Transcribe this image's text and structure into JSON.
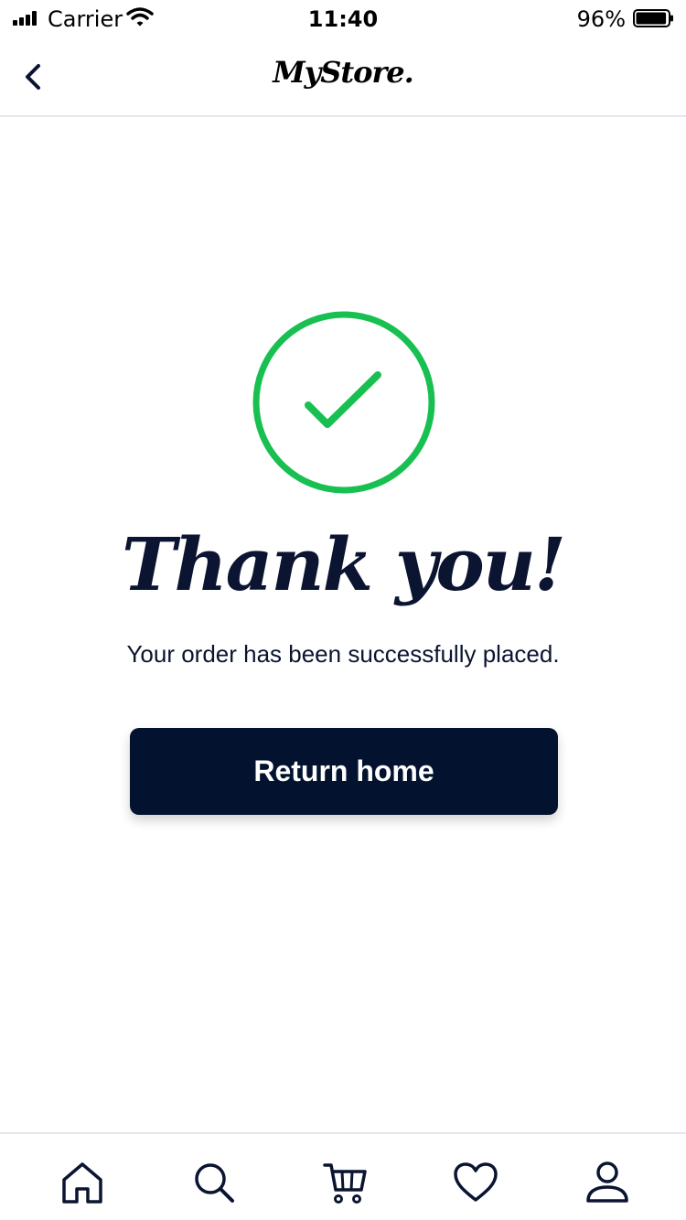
{
  "status_bar": {
    "carrier": "Carrier",
    "time": "11:40",
    "battery_percent": "96%",
    "battery_level": 0.96
  },
  "header": {
    "logo_text": "MyStore.",
    "back_icon": "chevron-left-icon"
  },
  "confirmation": {
    "icon": "check-circle-icon",
    "accent_color": "#17c050",
    "heading": "Thank you!",
    "message": "Your order has been successfully placed."
  },
  "actions": {
    "return_home_label": "Return home"
  },
  "tab_bar": {
    "items": [
      {
        "icon": "home-icon"
      },
      {
        "icon": "search-icon"
      },
      {
        "icon": "cart-icon"
      },
      {
        "icon": "heart-icon"
      },
      {
        "icon": "user-icon"
      }
    ]
  },
  "colors": {
    "primary": "#03132f",
    "success": "#17c050",
    "divider": "#e6e7ea"
  }
}
